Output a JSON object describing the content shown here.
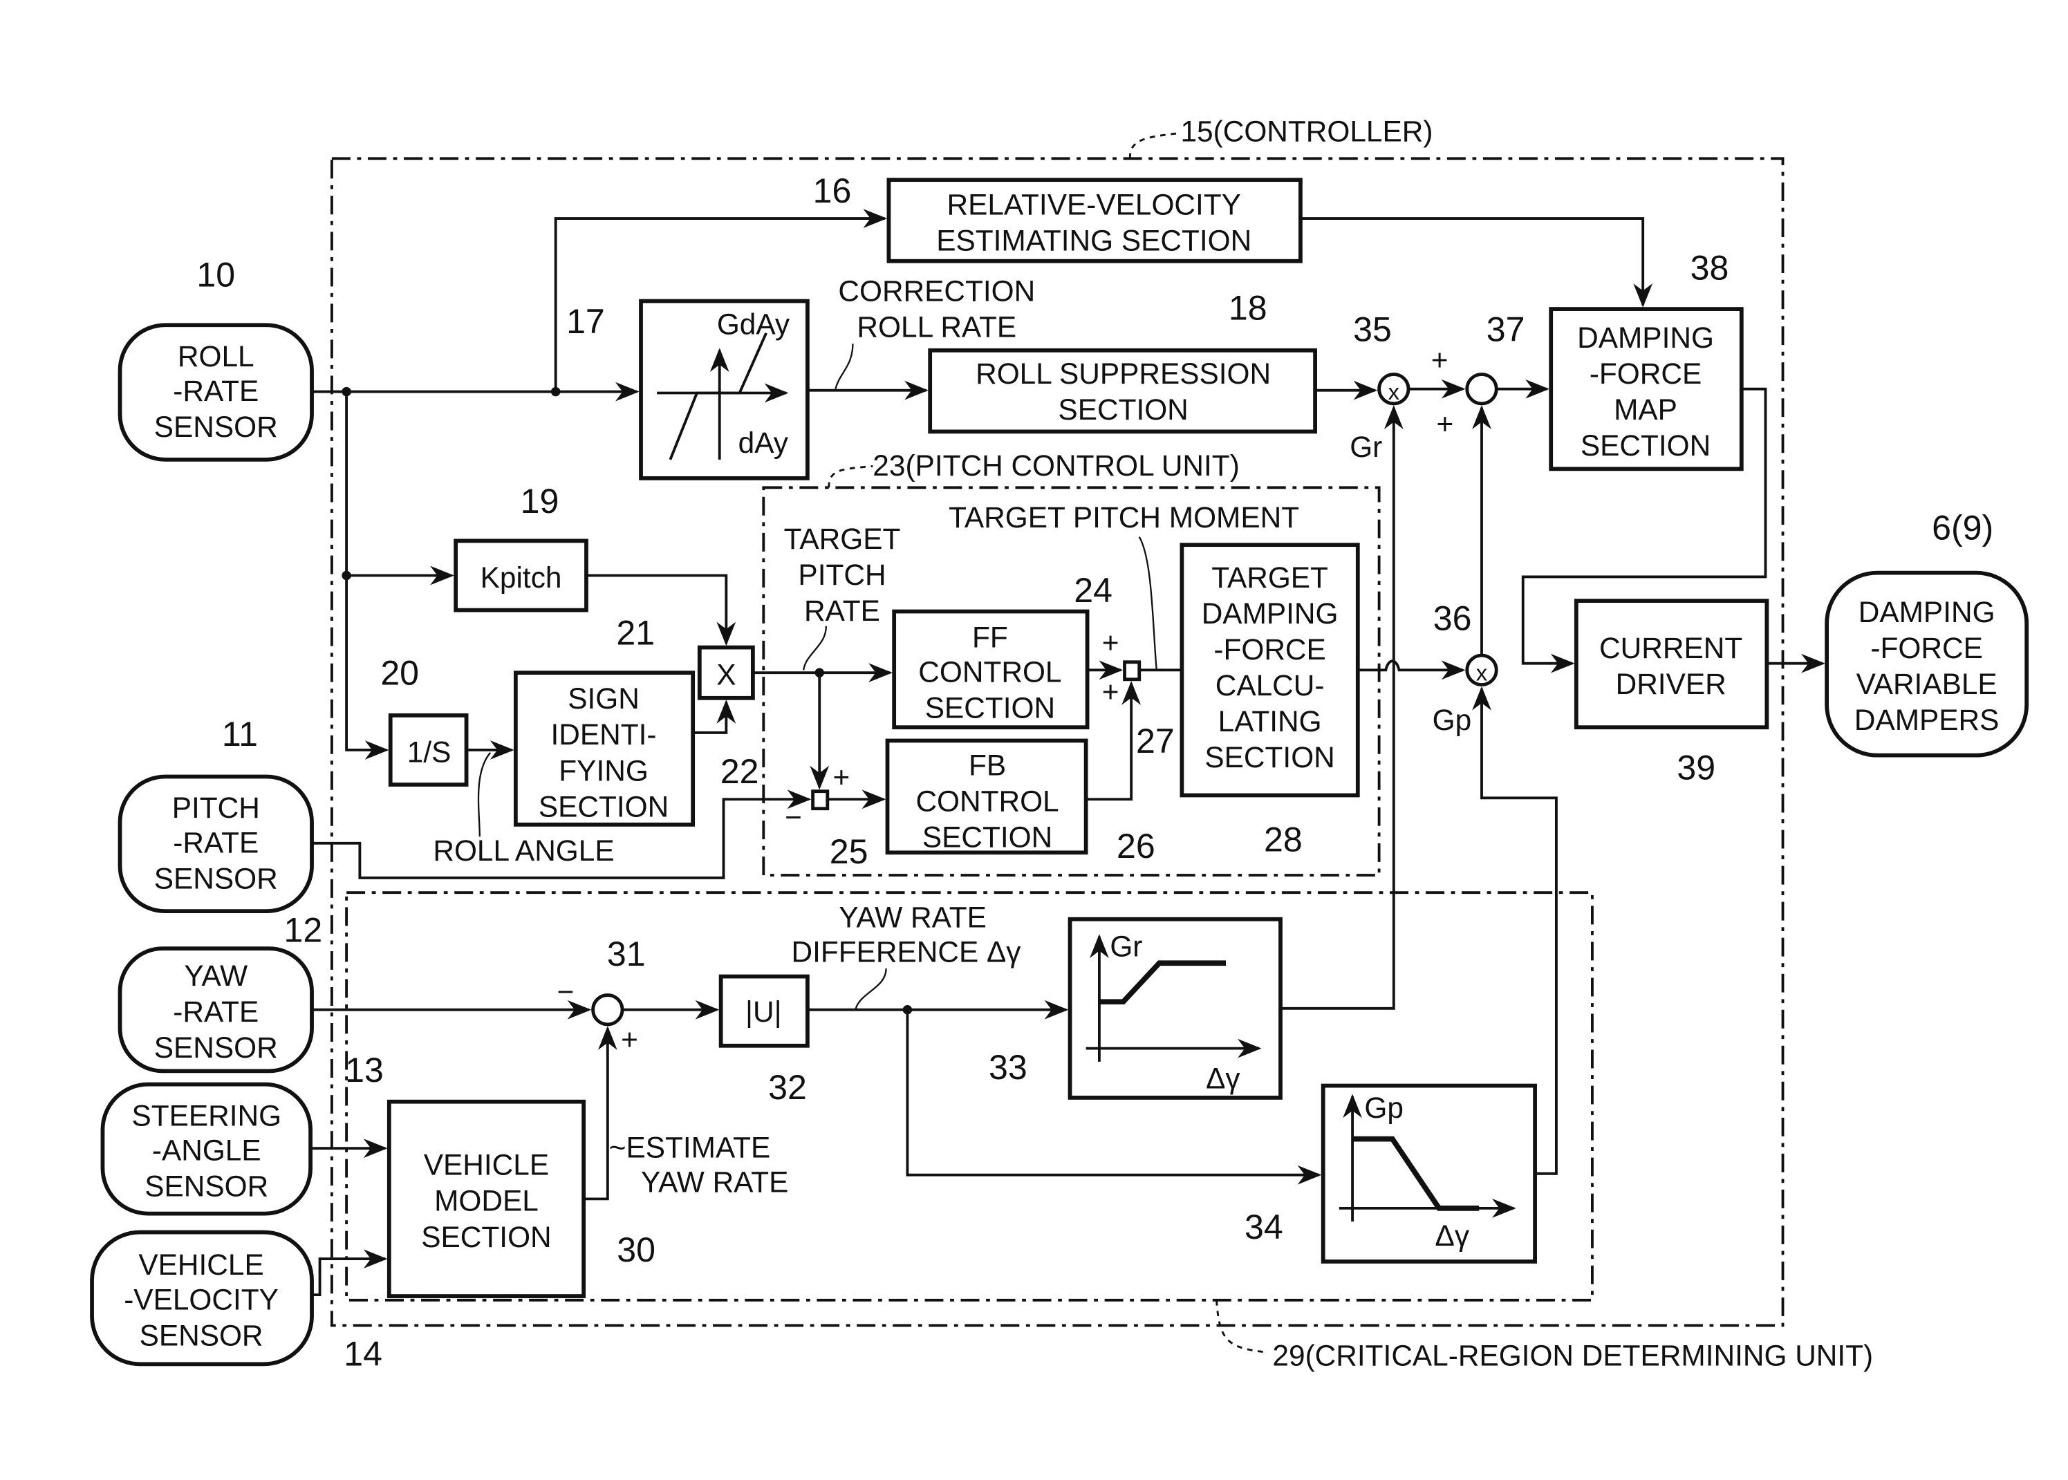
{
  "labels": {
    "controller": "15(CONTROLLER)",
    "pitch_unit": "23(PITCH CONTROL UNIT)",
    "critical_unit": "29(CRITICAL-REGION DETERMINING UNIT)"
  },
  "sensors": [
    {
      "id": "10",
      "lines": [
        "ROLL",
        "-RATE",
        "SENSOR"
      ]
    },
    {
      "id": "11",
      "lines": [
        "PITCH",
        "-RATE",
        "SENSOR"
      ]
    },
    {
      "id": "12",
      "lines": [
        "YAW",
        "-RATE",
        "SENSOR"
      ]
    },
    {
      "id": "13",
      "lines": [
        "STEERING",
        "-ANGLE",
        "SENSOR"
      ]
    },
    {
      "id": "14",
      "lines": [
        "VEHICLE",
        "-VELOCITY",
        "SENSOR"
      ]
    }
  ],
  "output": {
    "id": "6(9)",
    "lines": [
      "DAMPING",
      "-FORCE",
      "VARIABLE",
      "DAMPERS"
    ]
  },
  "blocks": {
    "b16": {
      "id": "16",
      "lines": [
        "RELATIVE-VELOCITY",
        "ESTIMATING SECTION"
      ]
    },
    "b17": {
      "id": "17",
      "y_label": "GdAy",
      "x_label": "dAy"
    },
    "b18": {
      "id": "18",
      "lines": [
        "ROLL SUPPRESSION",
        "SECTION"
      ]
    },
    "b19": {
      "id": "19",
      "text": "Kpitch"
    },
    "b20": {
      "id": "20",
      "text": "1/S"
    },
    "b21": {
      "id": "21",
      "lines": [
        "SIGN",
        "IDENTI-",
        "FYING",
        "SECTION"
      ]
    },
    "b22": {
      "id": "22",
      "text": "X"
    },
    "b24": {
      "id": "24",
      "lines": [
        "FF",
        "CONTROL",
        "SECTION"
      ]
    },
    "b26": {
      "id": "26",
      "lines": [
        "FB",
        "CONTROL",
        "SECTION"
      ]
    },
    "b28": {
      "id": "28",
      "lines": [
        "TARGET",
        "DAMPING",
        "-FORCE",
        "CALCU-",
        "LATING",
        "SECTION"
      ]
    },
    "b30": {
      "id": "30",
      "lines": [
        "VEHICLE",
        "MODEL",
        "SECTION"
      ]
    },
    "b32": {
      "id": "32",
      "text": "|U|"
    },
    "b33": {
      "id": "33",
      "y_label": "Gr",
      "x_label": "Δγ"
    },
    "b34": {
      "id": "34",
      "y_label": "Gp",
      "x_label": "Δγ"
    },
    "b38": {
      "id": "38",
      "lines": [
        "DAMPING",
        "-FORCE",
        "MAP",
        "SECTION"
      ]
    },
    "b39": {
      "id": "39",
      "lines": [
        "CURRENT",
        "DRIVER"
      ]
    }
  },
  "nodes": {
    "n25": "25",
    "n27": "27",
    "n31": "31",
    "n35": "35",
    "n36": "36",
    "n37": "37",
    "mult": "x",
    "plus": "+",
    "minus": "−"
  },
  "signals": {
    "correction_roll_rate": [
      "CORRECTION",
      "ROLL RATE"
    ],
    "target_pitch_rate": [
      "TARGET",
      "PITCH",
      "RATE"
    ],
    "target_pitch_moment": "TARGET PITCH MOMENT",
    "roll_angle": "ROLL ANGLE",
    "yaw_rate_difference": [
      "YAW RATE",
      "DIFFERENCE  Δγ"
    ],
    "estimate_yaw_rate": [
      "~ESTIMATE",
      "YAW RATE"
    ],
    "gr": "Gr",
    "gp": "Gp"
  }
}
